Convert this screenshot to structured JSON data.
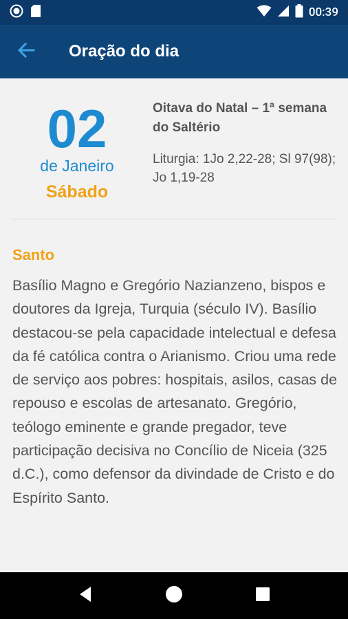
{
  "status_bar": {
    "time": "00:39",
    "icons": [
      "record-icon",
      "sd-card-icon",
      "wifi-icon",
      "signal-icon",
      "battery-icon"
    ]
  },
  "app_bar": {
    "title": "Oração do dia",
    "back_icon": "arrow-back-icon"
  },
  "date": {
    "day": "02",
    "month": "de Janeiro",
    "weekday": "Sábado"
  },
  "info": {
    "season": "Oitava do Natal – 1ª semana do Saltério",
    "liturgy": "Liturgia: 1Jo 2,22-28; Sl 97(98); Jo 1,19-28"
  },
  "saint": {
    "heading": "Santo",
    "text": "Basílio Magno e Gregório Nazianzeno, bispos e doutores da Igreja, Turquia (século IV). Basílio destacou-se pela capacidade intelectual e defesa da fé católica contra o Arianismo. Criou uma rede de serviço aos pobres: hospitais, asilos, casas de repouso e escolas de artesanato. Gregório, teólogo eminente e grande pregador, teve participação decisiva no Concílio de Niceia (325 d.C.), como defensor da divindade de Cristo e do Espírito Santo."
  },
  "nav_bar": {
    "icons": [
      "back-triangle-icon",
      "home-circle-icon",
      "recents-square-icon"
    ]
  },
  "colors": {
    "app_bar": "#0e4579",
    "status_bar": "#0b3a6a",
    "accent_blue": "#1e8bd1",
    "accent_orange": "#f0a21a",
    "text_gray": "#555555"
  }
}
